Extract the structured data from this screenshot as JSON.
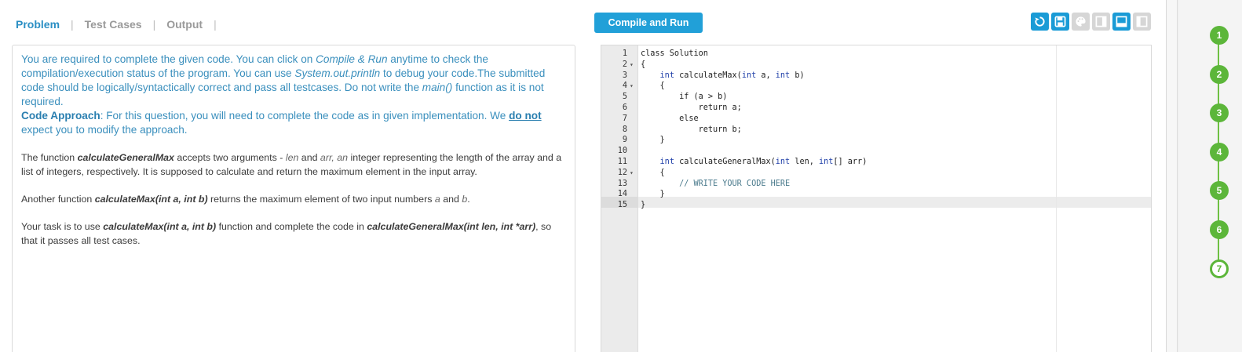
{
  "tabs": [
    {
      "label": "Problem",
      "active": true
    },
    {
      "label": "Test Cases",
      "active": false
    },
    {
      "label": "Output",
      "active": false
    }
  ],
  "tab_separator": "|",
  "problem": {
    "instr1": "You are required to complete the given code. You can click on ",
    "instr_compile": "Compile & Run",
    "instr2": " anytime to check the compilation/execution status of the program. You can use ",
    "instr_println": "System.out.println",
    "instr3": " to debug your code.The submitted code should be logically/syntactically correct and pass all testcases. Do not write the ",
    "instr_main": "main()",
    "instr4": " function as it is not required.",
    "approach_label": "Code Approach",
    "approach1": ": For this question, you will need to complete the code as in given implementation. We ",
    "approach_do_not": "do not",
    "approach2": " expect you to modify the approach.",
    "p1_a": "The function ",
    "p1_fn": "calculateGeneralMax",
    "p1_b": " accepts two arguments - ",
    "p1_len": "len",
    "p1_c": " and ",
    "p1_arr": "arr, an",
    "p1_d": " integer representing the length of the array and a list of integers, respectively. It is supposed to calculate and return the maximum element in the input array.",
    "p2_a": "Another function ",
    "p2_fn": "calculateMax(int a, int b)",
    "p2_b": " returns the maximum element of two input numbers ",
    "p2_a_var": "a",
    "p2_c": " and ",
    "p2_b_var": "b",
    "p2_d": ".",
    "p3_a": "Your task is to use ",
    "p3_fn1": "calculateMax(int a, int b)",
    "p3_b": " function and complete the code in ",
    "p3_fn2": "calculateGeneralMax(int len, int *arr)",
    "p3_c": ", so that it passes all test cases."
  },
  "toolbar": {
    "compile_label": "Compile and Run",
    "icons": [
      "reset-icon",
      "save-icon",
      "theme-palette-icon",
      "layout-split-icon",
      "layout-bottom-icon",
      "layout-side-icon"
    ]
  },
  "editor": {
    "lines": [
      {
        "n": "1",
        "fold": "",
        "code": "class Solution"
      },
      {
        "n": "2",
        "fold": "▾",
        "code": "{"
      },
      {
        "n": "3",
        "fold": "",
        "code": "    int calculateMax(int a, int b)"
      },
      {
        "n": "4",
        "fold": "▾",
        "code": "    {"
      },
      {
        "n": "5",
        "fold": "",
        "code": "        if (a > b)"
      },
      {
        "n": "6",
        "fold": "",
        "code": "            return a;"
      },
      {
        "n": "7",
        "fold": "",
        "code": "        else"
      },
      {
        "n": "8",
        "fold": "",
        "code": "            return b;"
      },
      {
        "n": "9",
        "fold": "",
        "code": "    }"
      },
      {
        "n": "10",
        "fold": "",
        "code": ""
      },
      {
        "n": "11",
        "fold": "",
        "code": "    int calculateGeneralMax(int len, int[] arr)"
      },
      {
        "n": "12",
        "fold": "▾",
        "code": "    {"
      },
      {
        "n": "13",
        "fold": "",
        "code": "        // WRITE YOUR CODE HERE"
      },
      {
        "n": "14",
        "fold": "",
        "code": "    }"
      },
      {
        "n": "15",
        "fold": "",
        "code": "}"
      }
    ]
  },
  "steps": {
    "items": [
      "1",
      "2",
      "3",
      "4",
      "5",
      "6",
      "7"
    ],
    "current": "7",
    "color": "#5cb63a"
  }
}
